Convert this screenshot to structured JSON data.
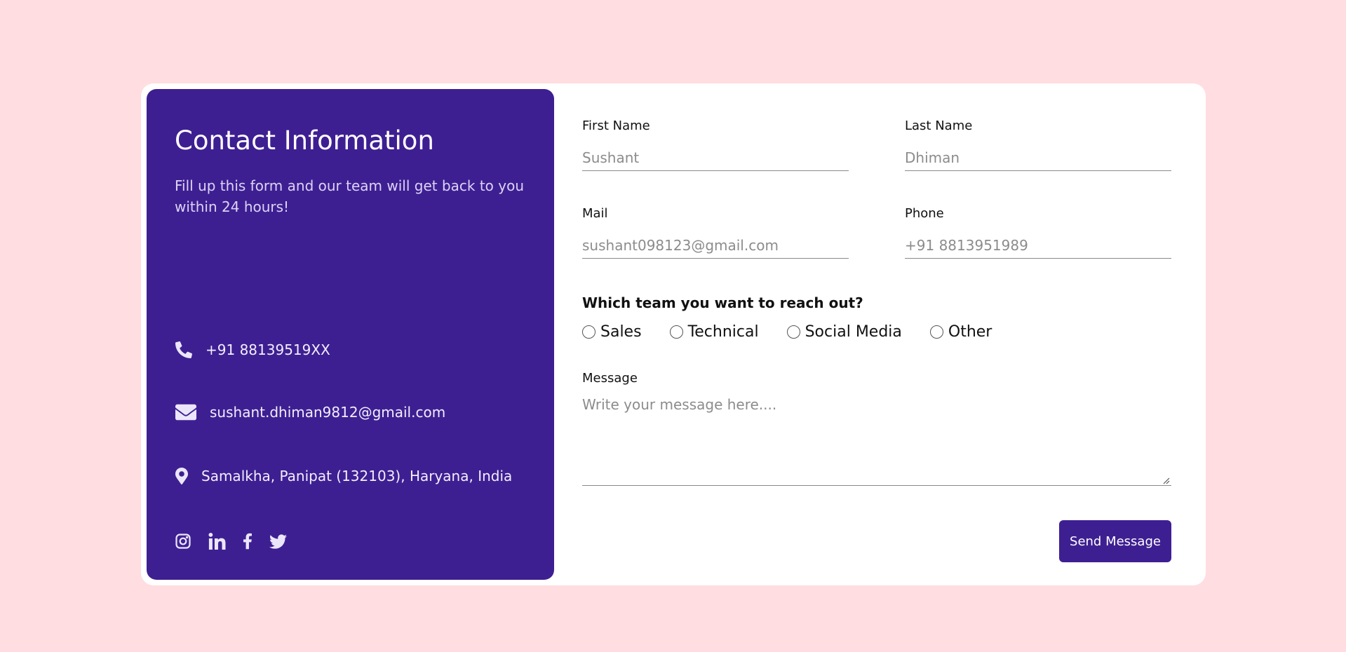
{
  "info": {
    "title": "Contact Information",
    "subtitle": "Fill up this form and our team will get back to you within 24 hours!",
    "phone": "+91 88139519XX",
    "email": "sushant.dhiman9812@gmail.com",
    "address": "Samalkha, Panipat (132103), Haryana, India",
    "icons": {
      "phone": "phone-icon",
      "email": "envelope-icon",
      "address": "location-pin-icon"
    },
    "socials": [
      "instagram-icon",
      "linkedin-icon",
      "facebook-icon",
      "twitter-icon"
    ]
  },
  "form": {
    "first_name": {
      "label": "First Name",
      "placeholder": "Sushant"
    },
    "last_name": {
      "label": "Last Name",
      "placeholder": "Dhiman"
    },
    "mail": {
      "label": "Mail",
      "placeholder": "sushant098123@gmail.com"
    },
    "phone": {
      "label": "Phone",
      "placeholder": "+91 8813951989"
    },
    "team_question": "Which team you want to reach out?",
    "team_options": [
      "Sales",
      "Technical",
      "Social Media",
      "Other"
    ],
    "message": {
      "label": "Message",
      "placeholder": "Write your message here...."
    },
    "submit_label": "Send Message"
  },
  "colors": {
    "background": "#ffdde0",
    "panel": "#3e1f92",
    "button": "#3e1f92"
  }
}
